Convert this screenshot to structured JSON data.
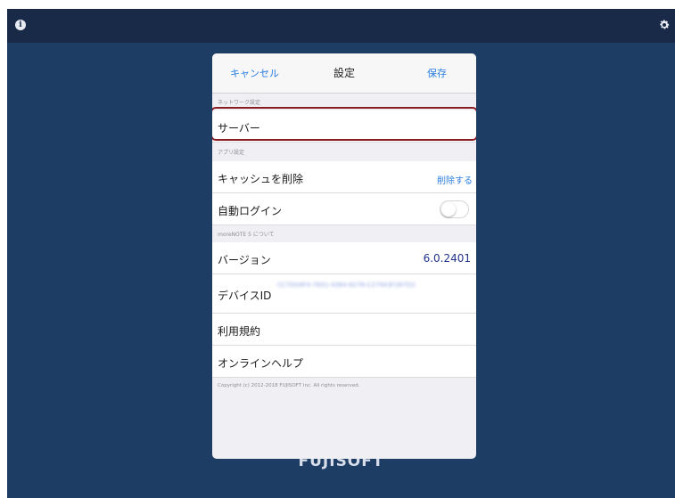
{
  "header": {
    "cancel_label": "キャンセル",
    "title": "設定",
    "save_label": "保存"
  },
  "sections": {
    "network": "ネットワーク設定",
    "app": "アプリ設定",
    "about": "moreNOTE 5 について"
  },
  "rows": {
    "server": "サーバー",
    "clear_cache": "キャッシュを削除",
    "clear_cache_action": "削除する",
    "auto_login": "自動ログイン",
    "version_label": "バージョン",
    "version_value": "6.0.2401",
    "device_id_label": "デバイスID",
    "device_id_value": "CC7D04F4-7E01-4384-8278-C27943F287D2",
    "terms": "利用規約",
    "online_help": "オンラインヘルプ"
  },
  "auto_login_enabled": false,
  "copyright": "Copyright (c) 2012-2018 FUJISOFT Inc. All rights reserved.",
  "brand": "FUJISOFT",
  "icons": {
    "info": "info-icon",
    "settings": "gear-icon"
  },
  "colors": {
    "accent": "#2b7ee0",
    "highlight": "#8a1c24",
    "background": "#1e3d64"
  }
}
